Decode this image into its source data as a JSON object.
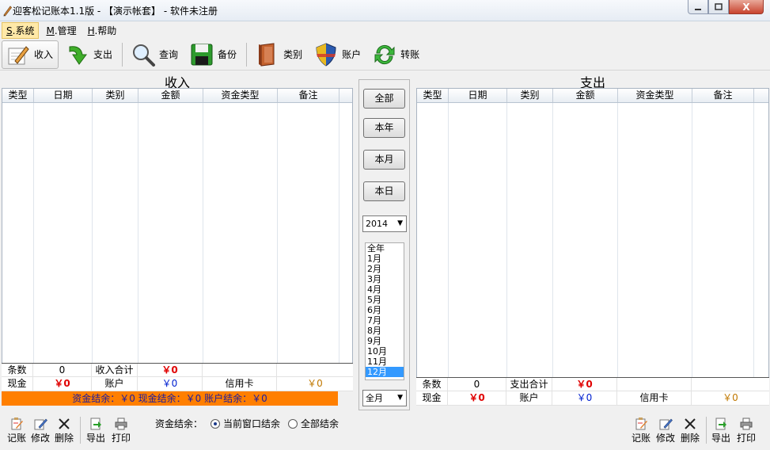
{
  "window": {
    "title": "迎客松记账本1.1版 - 【演示帐套】 - 软件未注册",
    "close_glyph": "X"
  },
  "menu": [
    {
      "key": "S",
      "label": ".系统"
    },
    {
      "key": "M",
      "label": ".管理"
    },
    {
      "key": "H",
      "label": ".帮助"
    }
  ],
  "toolbar": {
    "income": "收入",
    "expense": "支出",
    "query": "查询",
    "backup": "备份",
    "category": "类别",
    "account": "账户",
    "transfer": "转账"
  },
  "income_pane": {
    "title": "收入",
    "columns": [
      "类型",
      "日期",
      "类别",
      "金额",
      "资金类型",
      "备注"
    ],
    "summary": {
      "count_label": "条数",
      "count_value": "0",
      "total_label": "收入合计",
      "total_value": "￥0",
      "cash_label": "现金",
      "cash_value": "￥0",
      "account_label": "账户",
      "account_value": "￥0",
      "credit_label": "信用卡",
      "credit_value": "￥0"
    },
    "balance_bar": "资金结余：￥0  现金结余：￥0  账户结余：￥0"
  },
  "expense_pane": {
    "title": "支出",
    "columns": [
      "类型",
      "日期",
      "类别",
      "金额",
      "资金类型",
      "备注"
    ],
    "summary": {
      "count_label": "条数",
      "count_value": "0",
      "total_label": "支出合计",
      "total_value": "￥0",
      "cash_label": "现金",
      "cash_value": "￥0",
      "account_label": "账户",
      "account_value": "￥0",
      "credit_label": "信用卡",
      "credit_value": "￥0"
    }
  },
  "filters": {
    "all": "全部",
    "this_year": "本年",
    "this_month": "本月",
    "today": "本日",
    "year_value": "2014",
    "months": [
      "全年",
      "1月",
      "2月",
      "3月",
      "4月",
      "5月",
      "6月",
      "7月",
      "8月",
      "9月",
      "10月",
      "11月",
      "12月"
    ],
    "selected_month": "12月",
    "range_value": "全月"
  },
  "bottom": {
    "record": "记账",
    "edit": "修改",
    "delete": "删除",
    "export": "导出",
    "print": "打印",
    "balance_label": "资金结余：",
    "opt_current": "当前窗口结余",
    "opt_all": "全部结余"
  }
}
